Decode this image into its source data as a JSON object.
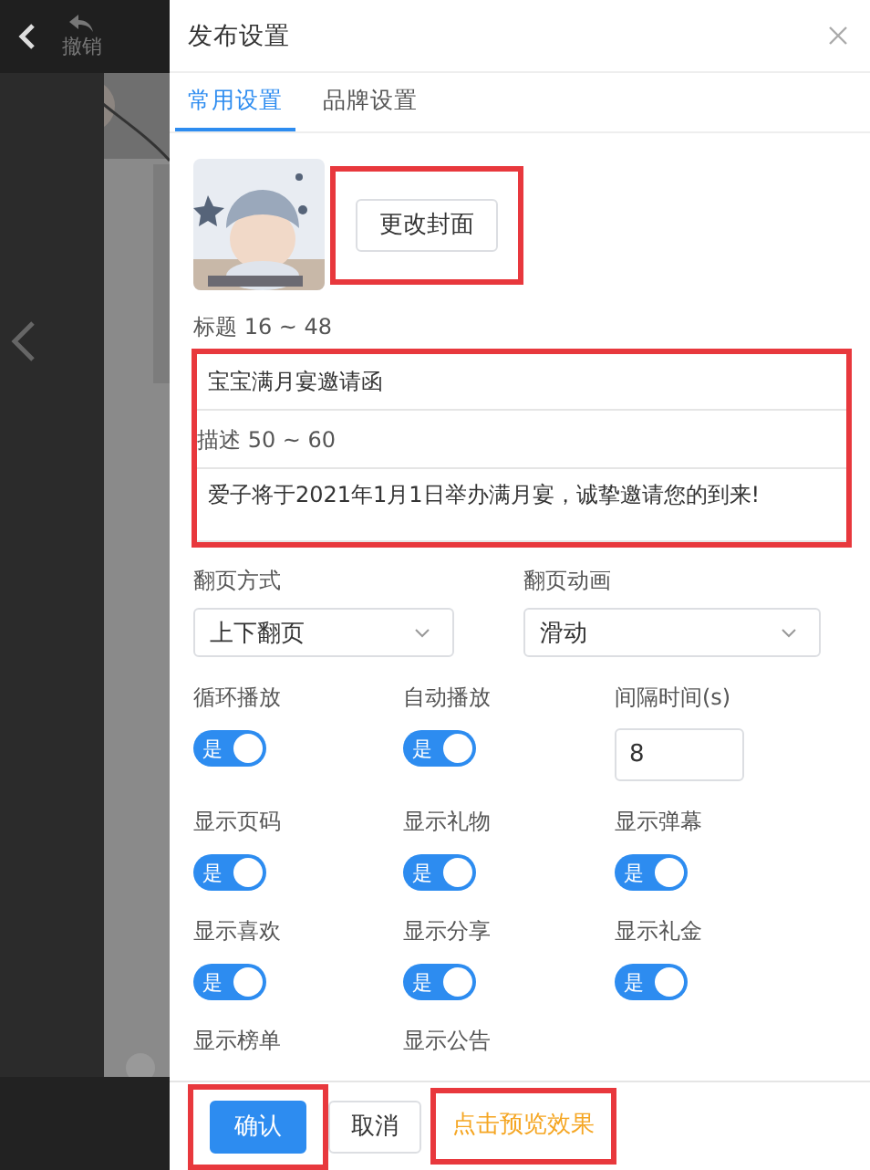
{
  "toolbar": {
    "undo_label": "撤销"
  },
  "panel": {
    "title": "发布设置",
    "tabs": [
      {
        "label": "常用设置",
        "selected": true
      },
      {
        "label": "品牌设置",
        "selected": false
      }
    ],
    "cover": {
      "kind": "picture",
      "button": "更改封面",
      "highlighted": true
    },
    "text_fields_highlighted": true,
    "title_field": {
      "label": "标题 16 ~ 48",
      "value": "宝宝满月宴邀请函"
    },
    "description_field": {
      "label": "描述 50 ~ 60",
      "value": "爱子将于2021年1月1日举办满月宴，诚挚邀请您的到来!"
    },
    "selects": [
      {
        "label": "翻页方式",
        "value": "上下翻页"
      },
      {
        "label": "翻页动画",
        "value": "滑动"
      }
    ],
    "options": [
      {
        "kind": "toggle",
        "label": "循环播放",
        "on": true,
        "state_text": "是"
      },
      {
        "kind": "toggle",
        "label": "自动播放",
        "on": true,
        "state_text": "是"
      },
      {
        "kind": "number",
        "label": "间隔时间(s)",
        "value": "8"
      },
      {
        "kind": "toggle",
        "label": "显示页码",
        "on": true,
        "state_text": "是"
      },
      {
        "kind": "toggle",
        "label": "显示礼物",
        "on": true,
        "state_text": "是"
      },
      {
        "kind": "toggle",
        "label": "显示弹幕",
        "on": true,
        "state_text": "是"
      },
      {
        "kind": "toggle",
        "label": "显示喜欢",
        "on": true,
        "state_text": "是"
      },
      {
        "kind": "toggle",
        "label": "显示分享",
        "on": true,
        "state_text": "是"
      },
      {
        "kind": "toggle",
        "label": "显示礼金",
        "on": true,
        "state_text": "是"
      },
      {
        "kind": "label_only",
        "label": "显示榜单"
      },
      {
        "kind": "label_only",
        "label": "显示公告"
      }
    ],
    "footer": [
      {
        "kind": "primary",
        "label": "确认",
        "highlighted": true
      },
      {
        "kind": "default",
        "label": "取消",
        "highlighted": false
      },
      {
        "kind": "link",
        "label": "点击预览效果",
        "highlighted": true
      }
    ]
  }
}
